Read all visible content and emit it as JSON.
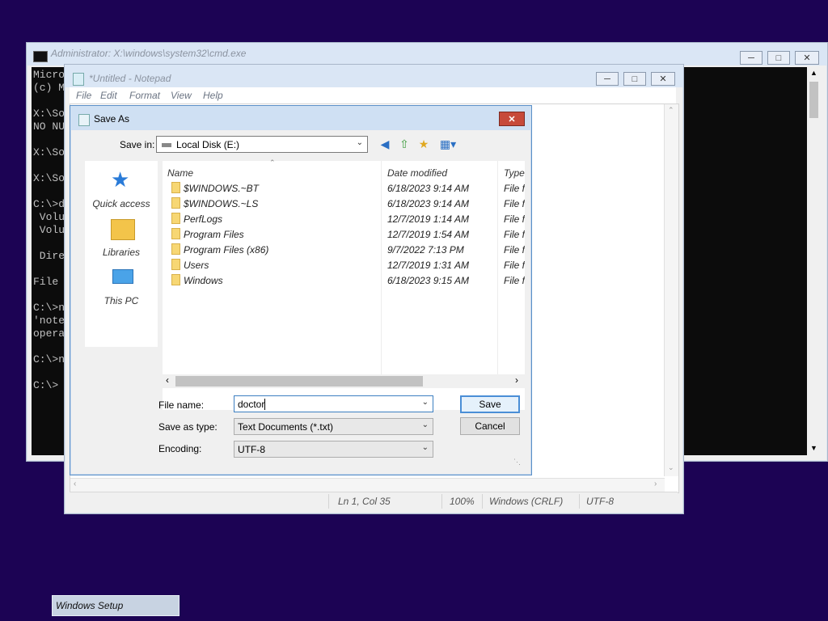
{
  "cmd": {
    "title": "Administrator: X:\\windows\\system32\\cmd.exe",
    "lines": [
      "Micro",
      "(c) M",
      "",
      "X:\\So",
      "NO NU",
      "",
      "X:\\So",
      "",
      "X:\\So",
      "",
      "C:\\>d",
      " Volu",
      " Volu",
      "",
      " Dire",
      "",
      "File",
      "",
      "C:\\>n",
      "'note",
      "opera",
      "",
      "C:\\>n",
      "",
      "C:\\>"
    ]
  },
  "notepad": {
    "title": "*Untitled - Notepad",
    "menu": [
      "File",
      "Edit",
      "Format",
      "View",
      "Help"
    ],
    "status": {
      "position": "Ln 1, Col 35",
      "zoom": "100%",
      "line_ending": "Windows (CRLF)",
      "encoding": "UTF-8"
    }
  },
  "saveas": {
    "title": "Save As",
    "save_in_label": "Save in:",
    "save_in_value": "Local Disk (E:)",
    "places": [
      "Quick access",
      "Libraries",
      "This PC"
    ],
    "columns": [
      "Name",
      "Date modified",
      "Type"
    ],
    "files": [
      {
        "name": "$WINDOWS.~BT",
        "date": "6/18/2023 9:14 AM",
        "type": "File fo"
      },
      {
        "name": "$WINDOWS.~LS",
        "date": "6/18/2023 9:14 AM",
        "type": "File fo"
      },
      {
        "name": "PerfLogs",
        "date": "12/7/2019 1:14 AM",
        "type": "File fo"
      },
      {
        "name": "Program Files",
        "date": "12/7/2019 1:54 AM",
        "type": "File fo"
      },
      {
        "name": "Program Files (x86)",
        "date": "9/7/2022 7:13 PM",
        "type": "File fo"
      },
      {
        "name": "Users",
        "date": "12/7/2019 1:31 AM",
        "type": "File fo"
      },
      {
        "name": "Windows",
        "date": "6/18/2023 9:15 AM",
        "type": "File fo"
      }
    ],
    "file_name_label": "File name:",
    "file_name_value": "doctor",
    "save_type_label": "Save as type:",
    "save_type_value": "Text Documents (*.txt)",
    "encoding_label": "Encoding:",
    "encoding_value": "UTF-8",
    "save_button": "Save",
    "cancel_button": "Cancel"
  },
  "taskbar": {
    "button": "Windows Setup"
  },
  "colors": {
    "desktop": "#1c0354",
    "console_bg": "#0c0c0c",
    "close_red": "#c74a3a",
    "accent": "#4a8ed6"
  }
}
